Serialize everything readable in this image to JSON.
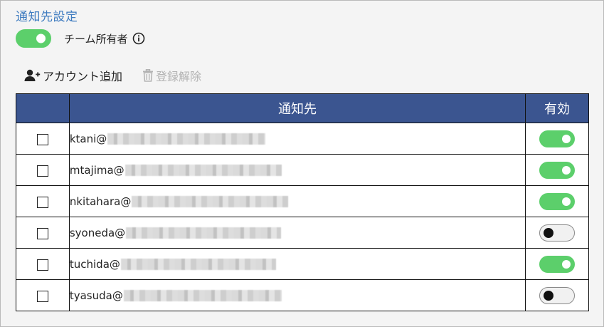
{
  "section": {
    "title": "通知先設定",
    "team_owner": {
      "label": "チーム所有者",
      "enabled": true,
      "icon": "info-icon"
    }
  },
  "toolbar": {
    "add_account": {
      "label": "アカウント追加",
      "icon": "add-user-icon"
    },
    "unregister": {
      "label": "登録解除",
      "icon": "trash-icon",
      "disabled": true
    }
  },
  "table": {
    "headers": {
      "check": "",
      "recipient": "通知先",
      "enabled": "有効"
    },
    "rows": [
      {
        "address": "ktani@",
        "enabled": true,
        "checked": false
      },
      {
        "address": "mtajima@",
        "enabled": true,
        "checked": false
      },
      {
        "address": "nkitahara@",
        "enabled": true,
        "checked": false
      },
      {
        "address": "syoneda@",
        "enabled": false,
        "checked": false
      },
      {
        "address": "tuchida@",
        "enabled": true,
        "checked": false
      },
      {
        "address": "tyasuda@",
        "enabled": false,
        "checked": false
      }
    ]
  },
  "colors": {
    "accent": "#3f7cc0",
    "header_bg": "#3b5590",
    "toggle_on": "#5ccf6b"
  }
}
